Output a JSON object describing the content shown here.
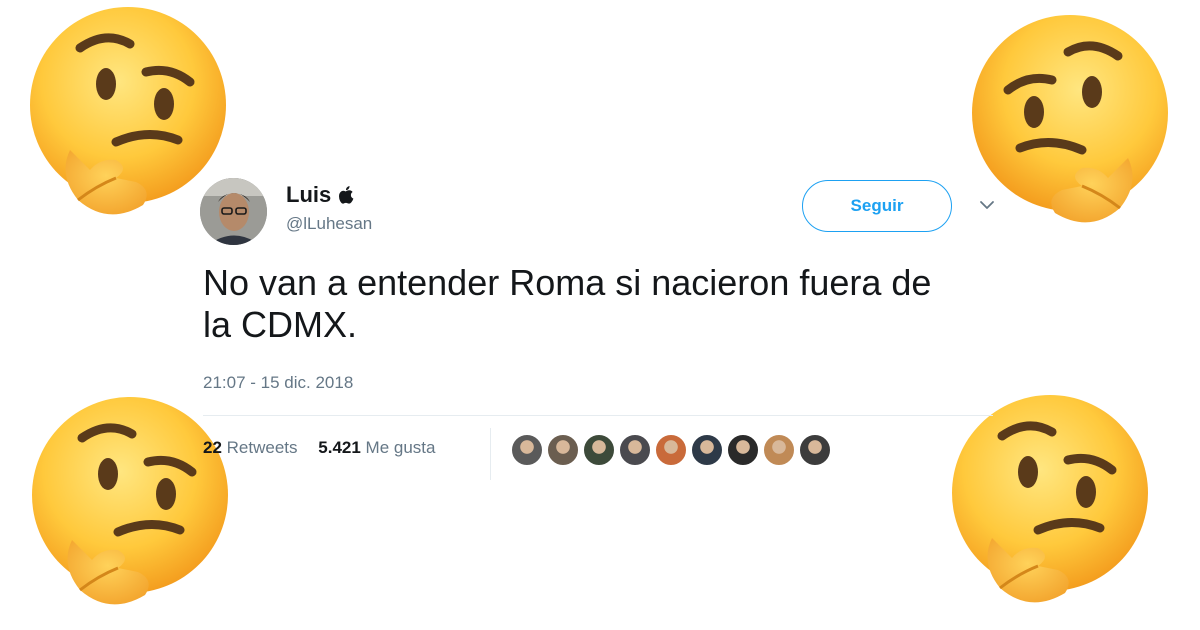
{
  "tweet": {
    "display_name": "Luis",
    "handle": "@lLuhesan",
    "follow_label": "Seguir",
    "text_line1": "No van a entender Roma si nacieron fuera de",
    "text_line2": "la CDMX.",
    "timestamp": "21:07 - 15 dic. 2018",
    "retweets_count": "22",
    "retweets_label": "Retweets",
    "likes_count": "5.421",
    "likes_label": "Me gusta",
    "liker_avatar_colors": [
      "#5a5a5a",
      "#6b5e50",
      "#3d4a3a",
      "#4a4a4f",
      "#c96a3a",
      "#2e3a48",
      "#2a2a2a",
      "#c08a56",
      "#3c3c3c"
    ]
  },
  "colors": {
    "brand": "#1da1f2",
    "text": "#14171a",
    "secondary": "#657786"
  },
  "decorations": [
    "thinking-face-emoji",
    "thinking-face-emoji",
    "thinking-face-emoji",
    "thinking-face-emoji"
  ]
}
